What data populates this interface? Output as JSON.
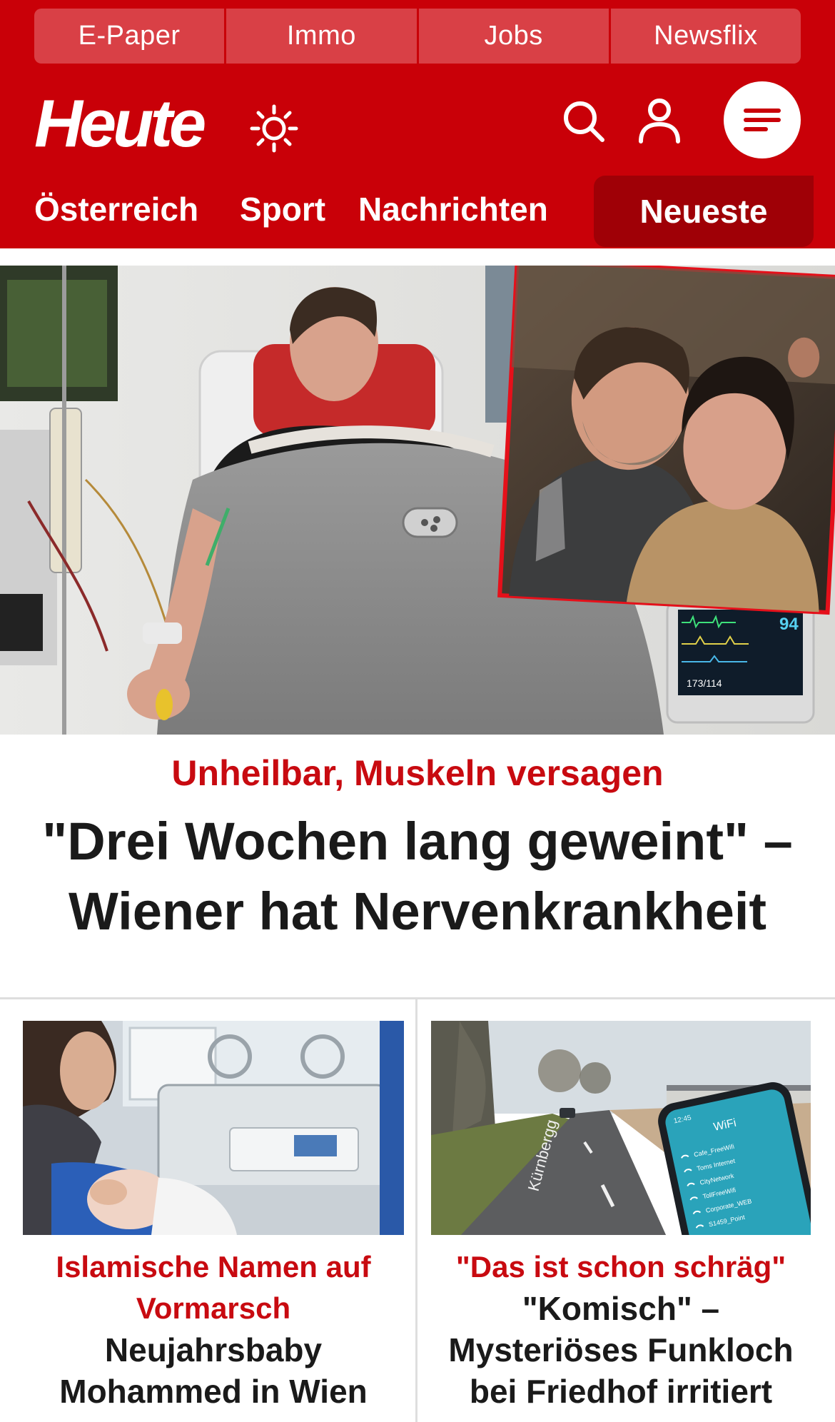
{
  "topbar": {
    "items": [
      "E-Paper",
      "Immo",
      "Jobs",
      "Newsflix"
    ]
  },
  "brand": {
    "logo": "Heute"
  },
  "nav": {
    "items": [
      "Österreich",
      "Sport",
      "Nachrichten"
    ],
    "active": "Neueste"
  },
  "hero": {
    "kicker": "Unheilbar, Muskeln versagen",
    "title": "\"Drei Wochen lang geweint\" – Wiener hat Nervenkrankheit",
    "monitor_reading": "94"
  },
  "cards": [
    {
      "kicker": "Islamische Namen auf Vormarsch",
      "title": "Neujahrsbaby Mohammed in Wien"
    },
    {
      "kicker": "\"Das ist schon schräg\"",
      "title": "\"Komisch\" – Mysteriöses Funkloch bei Friedhof irritiert",
      "street_sign": "Kürnbergg",
      "phone": {
        "time": "12:45",
        "header": "WiFi",
        "networks": [
          "Cafe_FreeWifi",
          "Toms Internet",
          "CityNetwork",
          "TollFreeWifi",
          "Corporate_WEB",
          "S1459_Point"
        ]
      }
    }
  ],
  "colors": {
    "brand_red": "#c90008",
    "topbar_red": "#d94046",
    "active_tab_red": "#9f0006",
    "kicker_red": "#c80a10",
    "title_text": "#1a1a1a"
  }
}
